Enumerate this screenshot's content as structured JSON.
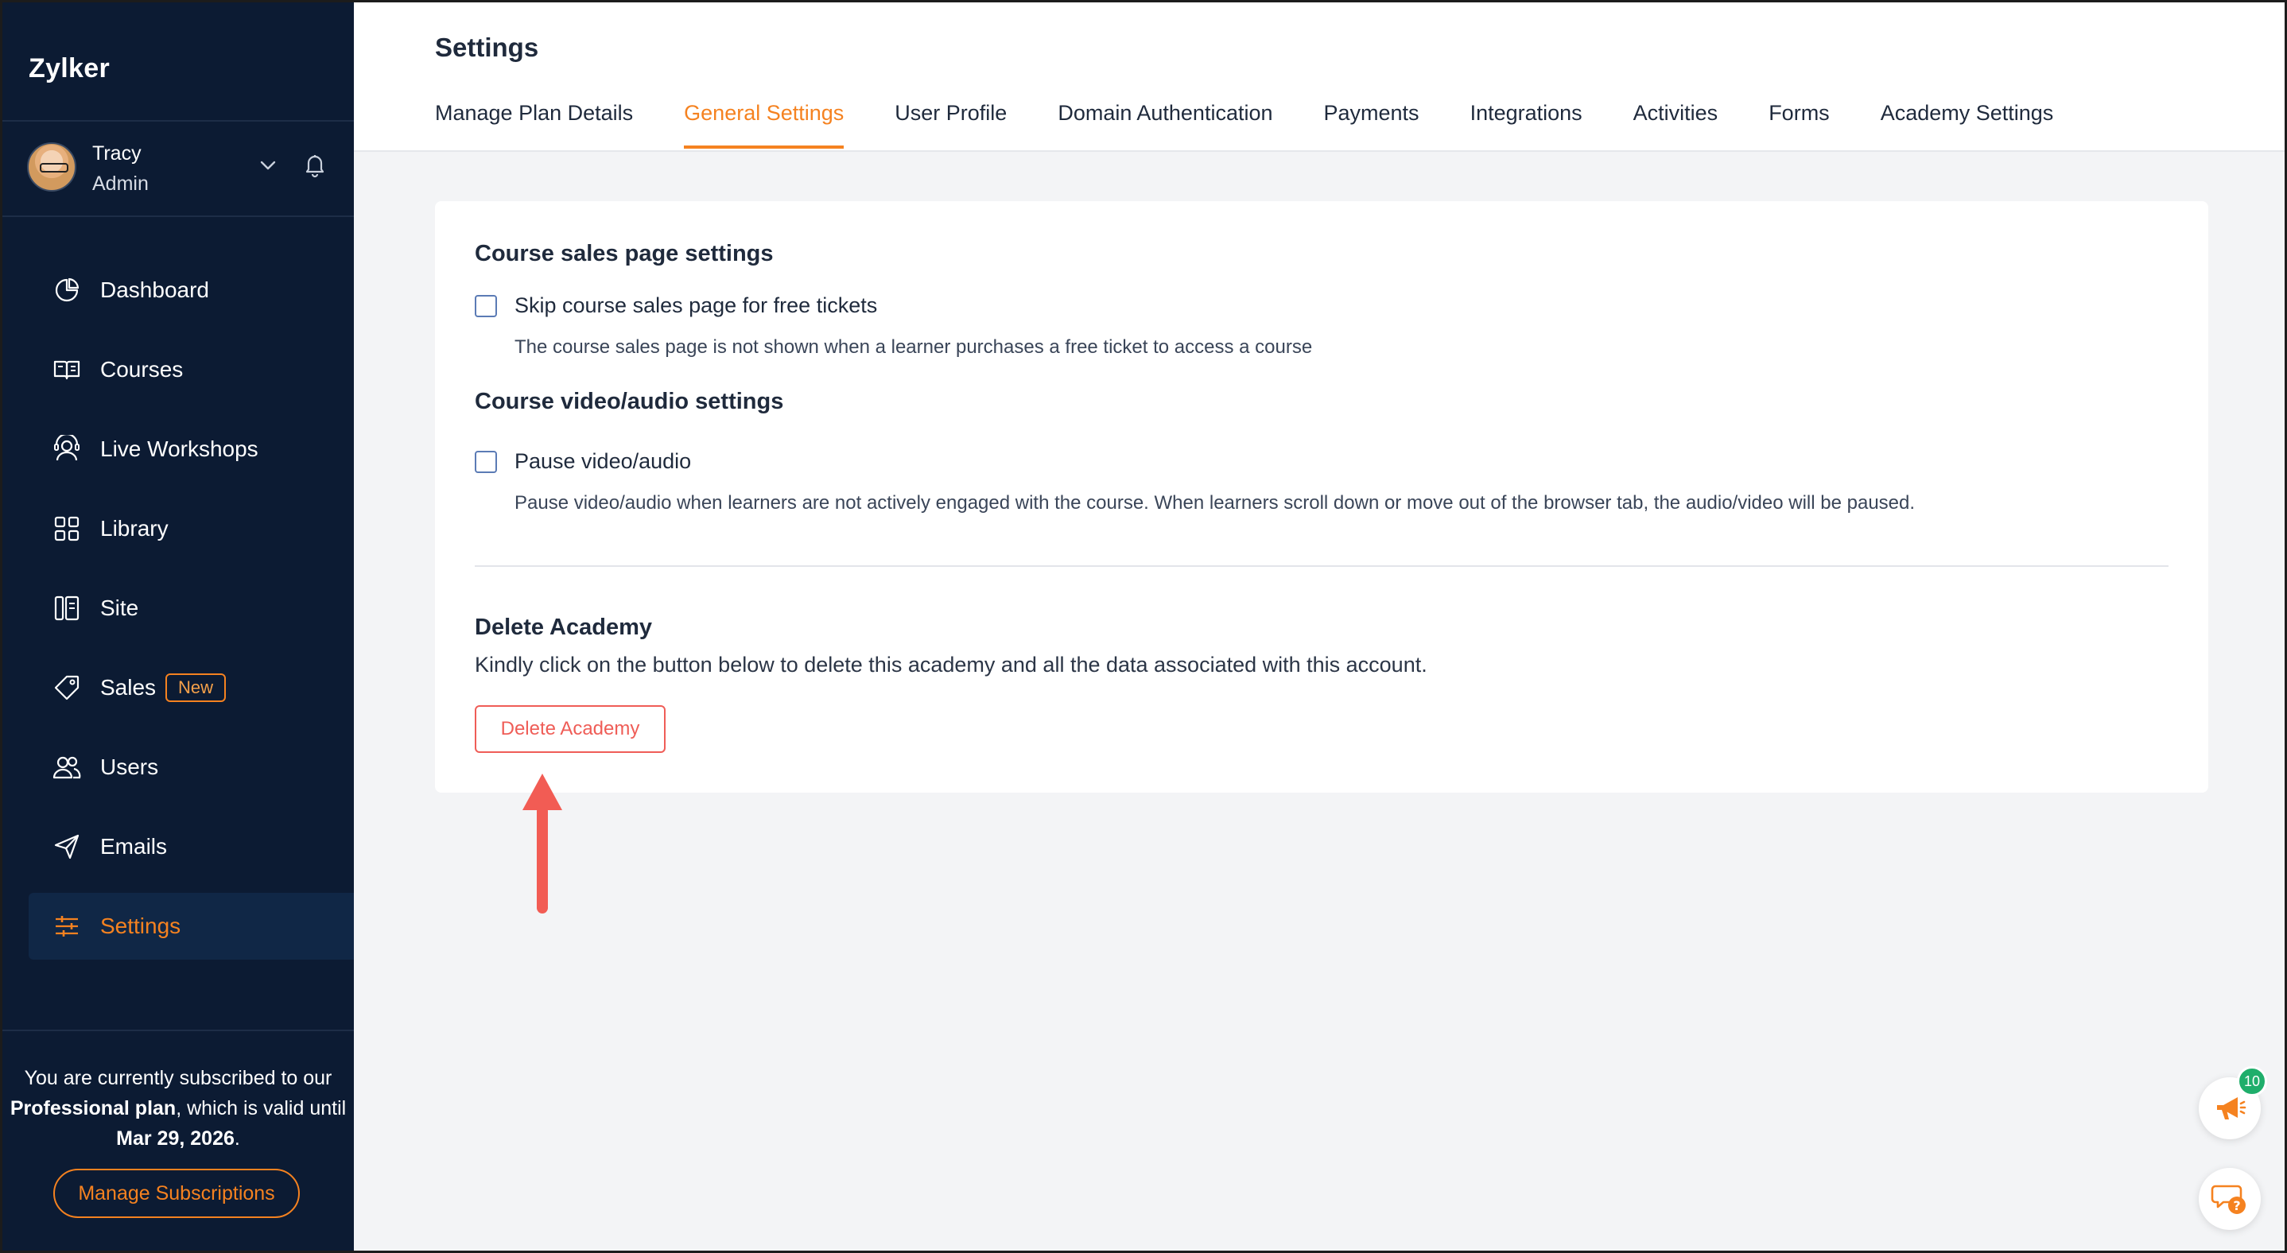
{
  "sidebar": {
    "brand": "Zylker",
    "user": {
      "name": "Tracy",
      "role": "Admin"
    },
    "nav": [
      {
        "label": "Dashboard",
        "icon": "dashboard-icon"
      },
      {
        "label": "Courses",
        "icon": "courses-icon"
      },
      {
        "label": "Live Workshops",
        "icon": "live-workshops-icon"
      },
      {
        "label": "Library",
        "icon": "library-icon"
      },
      {
        "label": "Site",
        "icon": "site-icon"
      },
      {
        "label": "Sales",
        "icon": "tag-icon",
        "badge": "New"
      },
      {
        "label": "Users",
        "icon": "users-icon"
      },
      {
        "label": "Emails",
        "icon": "send-icon"
      },
      {
        "label": "Settings",
        "icon": "settings-icon",
        "active": true
      }
    ],
    "subscription": {
      "pre": "You are currently subscribed to our ",
      "plan": "Professional plan",
      "mid": ", which is valid until ",
      "date": "Mar 29, 2026",
      "post": "."
    },
    "manage_label": "Manage Subscriptions"
  },
  "header": {
    "title": "Settings",
    "tabs": [
      {
        "label": "Manage Plan Details"
      },
      {
        "label": "General Settings",
        "active": true
      },
      {
        "label": "User Profile"
      },
      {
        "label": "Domain Authentication"
      },
      {
        "label": "Payments"
      },
      {
        "label": "Integrations"
      },
      {
        "label": "Activities"
      },
      {
        "label": "Forms"
      },
      {
        "label": "Academy Settings"
      }
    ]
  },
  "content": {
    "sales_page": {
      "title": "Course sales page settings",
      "option_label": "Skip course sales page for free tickets",
      "option_checked": false,
      "help": "The course sales page is not shown when a learner purchases a free ticket to access a course"
    },
    "media": {
      "title": "Course video/audio settings",
      "option_label": "Pause video/audio",
      "option_checked": false,
      "help": "Pause video/audio when learners are not actively engaged with the course. When learners scroll down or move out of the browser tab, the audio/video will be paused."
    },
    "delete": {
      "title": "Delete Academy",
      "desc": "Kindly click on the button below to delete this academy and all the data associated with this account.",
      "button": "Delete Academy"
    }
  },
  "floating": {
    "announcements_count": "10"
  },
  "colors": {
    "sidebar_bg": "#0c1b33",
    "accent": "#f58220",
    "danger": "#ef5d57",
    "arrow": "#f25c54",
    "badge_green": "#1fae6b"
  }
}
